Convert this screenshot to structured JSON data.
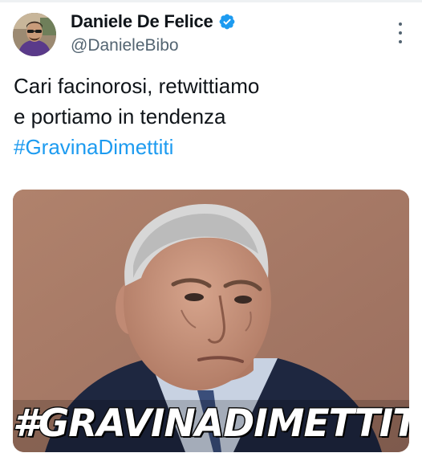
{
  "author": {
    "display_name": "Daniele De Felice",
    "handle": "@DanieleBibo",
    "verified": true,
    "avatar": "profile-photo"
  },
  "tweet": {
    "lines": [
      "Cari facinorosi, retwittiamo",
      "e portiamo in tendenza"
    ],
    "hashtag": "#GravinaDimettiti"
  },
  "media": {
    "overlay_text": "#GRAVINADIMETTITI"
  },
  "colors": {
    "link": "#1d9bf0",
    "verified_badge": "#1d9bf0",
    "secondary_text": "#536471"
  },
  "icons": {
    "verified": "verified-badge-icon",
    "more": "more-options-icon"
  }
}
